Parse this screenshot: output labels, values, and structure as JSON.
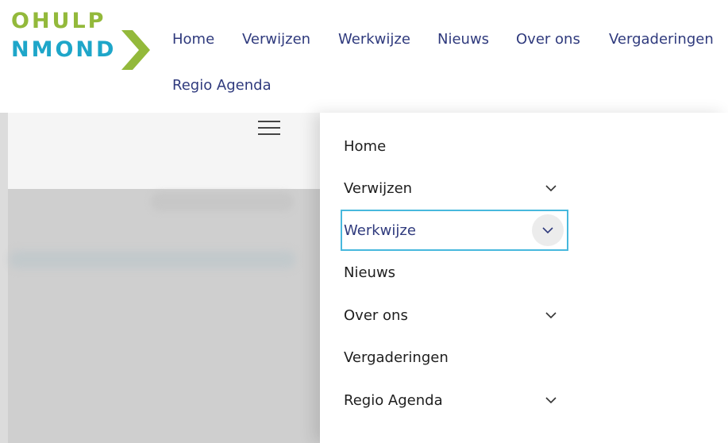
{
  "logo": {
    "line1": "OHULP",
    "line2": "NMOND",
    "colors": {
      "green": "#93b93b",
      "blue": "#1ea6c9"
    }
  },
  "topnav": {
    "items": [
      "Home",
      "Verwijzen",
      "Werkwijze",
      "Nieuws",
      "Over ons",
      "Vergaderingen",
      "Regio Agenda"
    ]
  },
  "drawer": {
    "items": [
      {
        "label": "Home",
        "has_submenu": false
      },
      {
        "label": "Verwijzen",
        "has_submenu": true
      },
      {
        "label": "Werkwijze",
        "has_submenu": true,
        "active": true
      },
      {
        "label": "Nieuws",
        "has_submenu": false
      },
      {
        "label": "Over ons",
        "has_submenu": true
      },
      {
        "label": "Vergaderingen",
        "has_submenu": false
      },
      {
        "label": "Regio Agenda",
        "has_submenu": true
      }
    ]
  },
  "theme": {
    "nav_text": "#2f3a7d",
    "focus_border": "#47b8dd"
  }
}
